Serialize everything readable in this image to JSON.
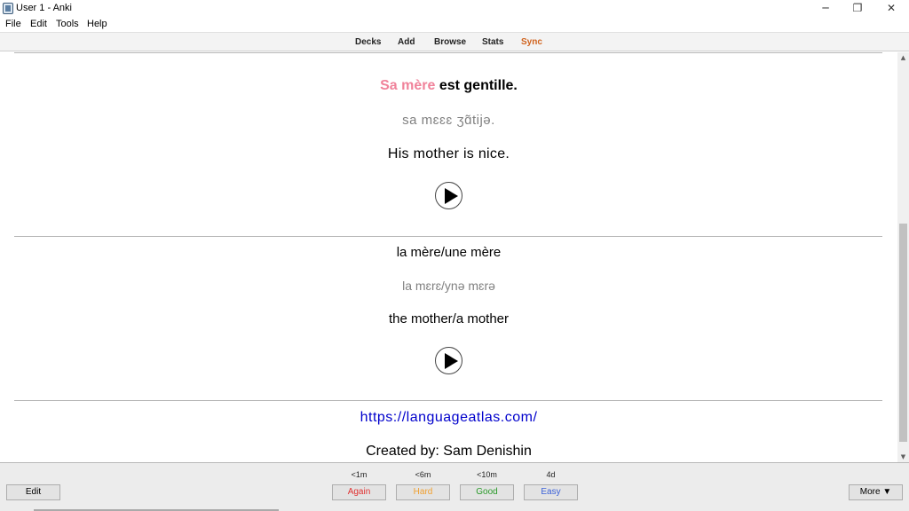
{
  "window": {
    "title": "User 1 - Anki",
    "minimize_glyph": "─",
    "restore_glyph": "❐",
    "close_glyph": "✕"
  },
  "menu": [
    "File",
    "Edit",
    "Tools",
    "Help"
  ],
  "toolbar": {
    "decks": "Decks",
    "add": "Add",
    "browse": "Browse",
    "stats": "Stats",
    "sync": "Sync",
    "sync_color": "#d0621c"
  },
  "card": {
    "sentence_highlight": "Sa mère",
    "sentence_rest": " est gentille.",
    "sentence_ipa": "sa mɛɛɛ ʒɑ̃tijə.",
    "sentence_translation": "His mother is nice.",
    "word": "la mère/une mère",
    "word_ipa": "la mɛrɛ/ynə mɛrə",
    "word_translation": "the mother/a mother",
    "link": "https://languageatlas.com/",
    "credit": "Created by: Sam Denishin",
    "highlight_color": "#f0829a"
  },
  "icons": {
    "play_1": "play-audio-icon",
    "play_2": "play-audio-icon",
    "scroll_up": "▲",
    "scroll_down": "▼"
  },
  "bottom": {
    "edit": "Edit",
    "more": "More ▼",
    "answers": [
      {
        "time": "<1m",
        "label": "Again",
        "color": "#e03030"
      },
      {
        "time": "<6m",
        "label": "Hard",
        "color": "#f0a030"
      },
      {
        "time": "<10m",
        "label": "Good",
        "color": "#2a9a2a"
      },
      {
        "time": "4d",
        "label": "Easy",
        "color": "#3a60d8"
      }
    ]
  }
}
